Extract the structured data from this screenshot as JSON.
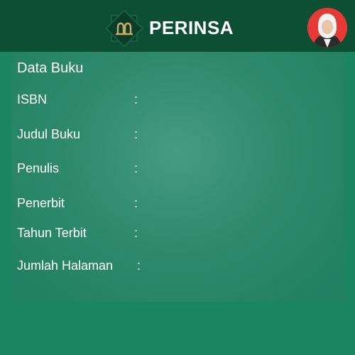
{
  "header": {
    "app_title": "PERINSA",
    "logo_icon": "perinsa-logo-icon",
    "avatar_icon": "user-avatar-icon",
    "background_color": "#0d4f35",
    "avatar_background_color": "#e53935"
  },
  "content": {
    "section_title": "Data Buku",
    "rows": [
      {
        "label": "ISBN",
        "separator": ":"
      },
      {
        "label": "Judul Buku",
        "separator": ":"
      },
      {
        "label": "Penulis",
        "separator": ":"
      },
      {
        "label": "Penerbit",
        "separator": ":"
      },
      {
        "label": "Tahun Terbit",
        "separator": ":"
      },
      {
        "label": "Jumlah Halaman",
        "separator": ":"
      }
    ]
  },
  "colors": {
    "page_background": "#1a8560",
    "card_highlight": "#469b80",
    "logo_gold": "#c8a862"
  }
}
